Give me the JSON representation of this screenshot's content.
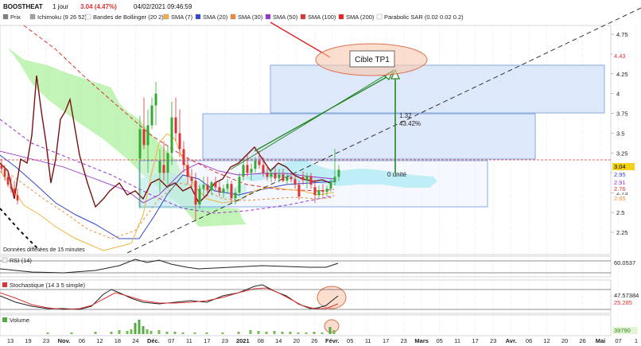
{
  "header": {
    "symbol": "BOOSTHEAT",
    "period": "1 jour",
    "change": "3.04 (4.47%)",
    "datetime": "04/02/2021 09:46:59"
  },
  "legend": [
    {
      "label": "Prix",
      "color": "#7f7f7f"
    },
    {
      "label": "Ichimoku (9 26 52)",
      "color": "#a0a0a0"
    },
    {
      "label": "Bandes de Bollinger (20 2)",
      "color": "#ffffff"
    },
    {
      "label": "SMA (7)",
      "color": "#f3b23a"
    },
    {
      "label": "SMA (20)",
      "color": "#3344cc"
    },
    {
      "label": "SMA (30)",
      "color": "#f08a3a"
    },
    {
      "label": "SMA (50)",
      "color": "#9933cc"
    },
    {
      "label": "SMA (100)",
      "color": "#dd3333"
    },
    {
      "label": "SMA (200)",
      "color": "#ee2222"
    },
    {
      "label": "Parabolic SAR (0.02 0.02 0.2)",
      "color": "#ffffff"
    }
  ],
  "annotations": {
    "target_label": "Cible TP1",
    "move_value": "1.32",
    "move_pct": "43.42%",
    "zero_label": "0 unité",
    "data_note": "Données différées de 15 minutes"
  },
  "price_axis": {
    "ticks": [
      "4.75",
      "4.5",
      "4.25",
      "4",
      "3.75",
      "3.5",
      "3.25",
      "3",
      "2.75",
      "2.5",
      "2.25"
    ],
    "badges": [
      {
        "text": "4.43",
        "color": "#dd3333",
        "bg": "#ffffff"
      },
      {
        "text": "3.04",
        "color": "#000000",
        "bg": "#f2d21b"
      },
      {
        "text": "2.95",
        "color": "#3344cc",
        "bg": "#ffffff"
      },
      {
        "text": "2.91",
        "color": "#9933cc",
        "bg": "#ffffff"
      },
      {
        "text": "2.76",
        "color": "#dd3333",
        "bg": "#ffffff"
      },
      {
        "text": "2.65",
        "color": "#f08a3a",
        "bg": "#ffffff"
      }
    ]
  },
  "panels": {
    "rsi": {
      "label": "RSI (14)",
      "value": "60.0537"
    },
    "stoch": {
      "label": "Stochastique (14 3 5 simple)",
      "value1": "47.57384",
      "value2": "25.285"
    },
    "volume": {
      "label": "Volume",
      "value": "39790"
    }
  },
  "x_axis": {
    "labels": [
      "13",
      "19",
      "23",
      "Nov.",
      "06",
      "12",
      "18",
      "24",
      "Déc.",
      "07",
      "11",
      "17",
      "23",
      "2021",
      "08",
      "14",
      "20",
      "26",
      "Févr.",
      "05",
      "11",
      "17",
      "23",
      "Mars",
      "05",
      "11",
      "17",
      "23",
      "Avr.",
      "06",
      "12",
      "20",
      "26",
      "Mai",
      "07",
      "1"
    ]
  },
  "chart_data": {
    "type": "candlestick",
    "title": "BOOSTHEAT",
    "period": "1 jour",
    "last_price": 3.04,
    "ylim": [
      2.1,
      4.85
    ],
    "price_ticks": [
      4.75,
      4.5,
      4.25,
      4,
      3.75,
      3.5,
      3.25,
      3,
      2.75,
      2.5,
      2.25
    ],
    "target": 4.36,
    "zones": [
      {
        "from": 3.78,
        "to": 4.36
      },
      {
        "from": 3.18,
        "to": 3.77
      },
      {
        "from": 2.55,
        "to": 3.18
      }
    ],
    "candles_recent": [
      {
        "o": 3.18,
        "h": 3.72,
        "l": 2.55,
        "c": 3.55
      },
      {
        "o": 3.55,
        "h": 3.95,
        "l": 3.3,
        "c": 3.35
      },
      {
        "o": 3.35,
        "h": 3.8,
        "l": 3.0,
        "c": 3.6
      },
      {
        "o": 3.6,
        "h": 3.95,
        "l": 3.55,
        "c": 3.85
      },
      {
        "o": 3.85,
        "h": 4.15,
        "l": 3.6,
        "c": 4.0
      },
      {
        "o": 2.95,
        "h": 3.02,
        "l": 2.85,
        "c": 2.91
      },
      {
        "o": 2.91,
        "h": 3.0,
        "l": 2.8,
        "c": 2.96
      },
      {
        "o": 2.96,
        "h": 3.0,
        "l": 2.8,
        "c": 2.85
      },
      {
        "o": 2.82,
        "h": 2.92,
        "l": 2.62,
        "c": 2.72
      },
      {
        "o": 2.72,
        "h": 2.84,
        "l": 2.68,
        "c": 2.78
      },
      {
        "o": 2.78,
        "h": 2.86,
        "l": 2.7,
        "c": 2.76
      },
      {
        "o": 2.76,
        "h": 2.84,
        "l": 2.7,
        "c": 2.8
      },
      {
        "o": 2.8,
        "h": 2.92,
        "l": 2.76,
        "c": 2.88
      },
      {
        "o": 2.88,
        "h": 3.3,
        "l": 2.84,
        "c": 2.95
      },
      {
        "o": 2.95,
        "h": 3.1,
        "l": 2.9,
        "c": 3.04
      }
    ],
    "rsi": 60.0537,
    "stochastic": [
      47.57384,
      25.285
    ],
    "volume_last": 39790
  }
}
